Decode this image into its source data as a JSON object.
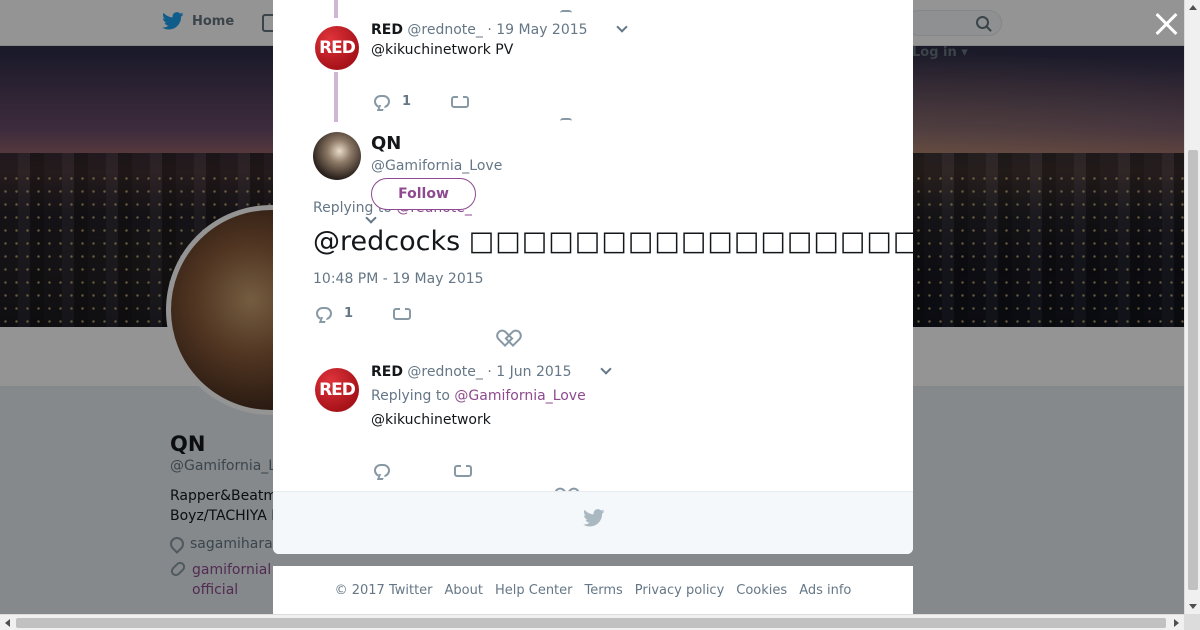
{
  "nav": {
    "home_label": "Home",
    "login_label": "Log in"
  },
  "profile": {
    "name": "QN",
    "handle": "@Gamifornia_L",
    "bio_line1": "Rapper&Beatm",
    "bio_line2": "Boyz/TACHIYA I",
    "location": "sagamihara city",
    "link_line1": "gamifornial",
    "link_line2": "official"
  },
  "modal": {
    "tweet1": {
      "name": "RED",
      "handle": "@rednote_",
      "date": "· 19 May 2015",
      "text": "@kikuchinetwork PV",
      "replies": "1"
    },
    "main": {
      "name": "QN",
      "handle": "@Gamifornia_Love",
      "follow_label": "Follow",
      "replying_prefix": "Replying to",
      "replying_to": "@rednote_",
      "text_mention": "@redcocks",
      "text_body": "□□□□□□□□□□□□□□□□□□□□□□□□□□□□□□□□□□□□□□□□□□□",
      "timestamp": "10:48 PM - 19 May 2015",
      "replies": "1"
    },
    "tweet2": {
      "name": "RED",
      "handle": "@rednote_",
      "date": "· 1 Jun 2015",
      "replying_prefix": "Replying to",
      "replying_to": "@Gamifornia_Love",
      "text": "@kikuchinetwork"
    }
  },
  "footer": {
    "copyright": "© 2017 Twitter",
    "links": [
      "About",
      "Help Center",
      "Terms",
      "Privacy policy",
      "Cookies",
      "Ads info"
    ]
  },
  "colors": {
    "accent": "#8d4a8f",
    "brand_red": "#c4161c",
    "twitter_blue": "#1da1f2"
  }
}
